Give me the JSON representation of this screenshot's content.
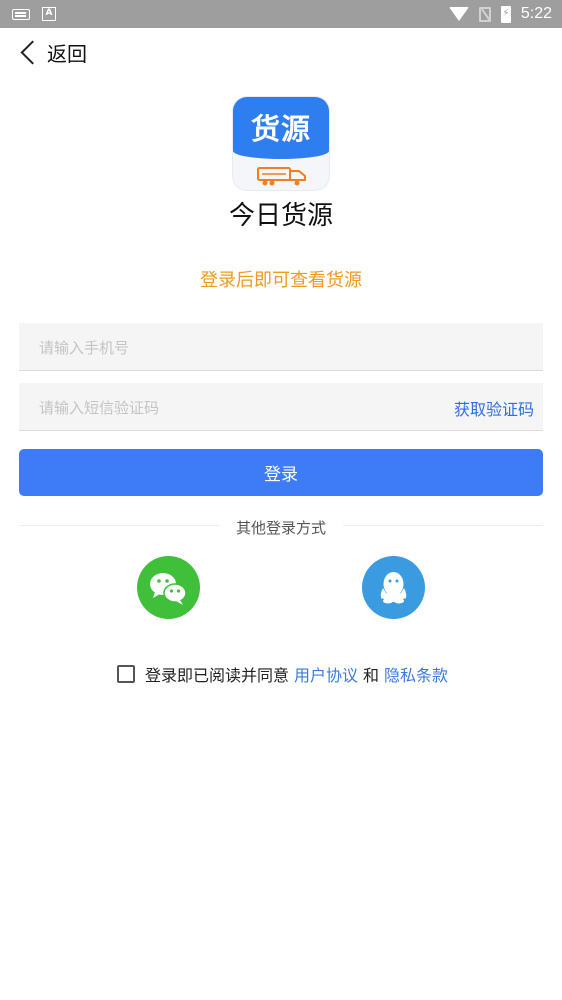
{
  "status_bar": {
    "time": "5:22",
    "left_icons": [
      "keyboard-icon",
      "a-icon"
    ],
    "right_icons": [
      "wifi-icon",
      "no-sim-icon",
      "battery-charging-icon"
    ]
  },
  "header": {
    "back_label": "返回"
  },
  "logo": {
    "badge_text": "货源",
    "brand_color": "#2f7ef0",
    "accent_color": "#ef7f22"
  },
  "app_name": "今日货源",
  "subtitle": "登录后即可查看货源",
  "form": {
    "phone_placeholder": "请输入手机号",
    "code_placeholder": "请输入短信验证码",
    "get_code_label": "获取验证码",
    "login_label": "登录"
  },
  "other_login": {
    "label": "其他登录方式",
    "providers": [
      {
        "name": "wechat",
        "icon": "wechat-icon",
        "color": "#3fbf3a"
      },
      {
        "name": "qq",
        "icon": "qq-icon",
        "color": "#3a9be0"
      }
    ]
  },
  "agreement": {
    "checked": false,
    "prefix": "登录即已阅读并同意",
    "user_agreement": "用户协议",
    "and": "和",
    "privacy": "隐私条款"
  }
}
